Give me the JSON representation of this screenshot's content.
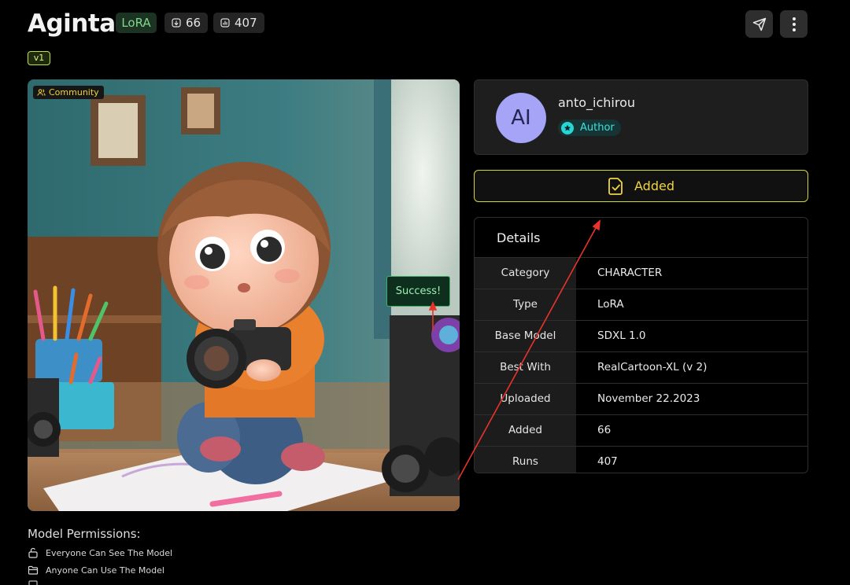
{
  "header": {
    "title": "Aginta",
    "type_badge": "LoRA",
    "downloads": "66",
    "runs": "407",
    "version": "v1"
  },
  "image": {
    "tag": "Community",
    "toast": "Success!"
  },
  "author": {
    "initials": "AI",
    "name": "anto_ichirou",
    "role": "Author"
  },
  "add_button": {
    "label": "Added"
  },
  "details": {
    "heading": "Details",
    "rows": [
      {
        "key": "Category",
        "value": "CHARACTER"
      },
      {
        "key": "Type",
        "value": "LoRA"
      },
      {
        "key": "Base Model",
        "value": "SDXL 1.0"
      },
      {
        "key": "Best With",
        "value": "RealCartoon-XL (v 2)"
      },
      {
        "key": "Uploaded",
        "value": "November 22.2023"
      },
      {
        "key": "Added",
        "value": "66"
      },
      {
        "key": "Runs",
        "value": "407"
      }
    ]
  },
  "permissions": {
    "heading": "Model Permissions:",
    "items": [
      "Everyone Can See The Model",
      "Anyone Can Use The Model"
    ]
  },
  "icons": {
    "share": "send-icon",
    "more": "more-vertical-icon",
    "add": "file-check-icon"
  },
  "colors": {
    "accent_yellow": "#f0d541",
    "author_cyan": "#28d7d5",
    "success_green": "#3fb068",
    "annotation_red": "#e8332a"
  }
}
